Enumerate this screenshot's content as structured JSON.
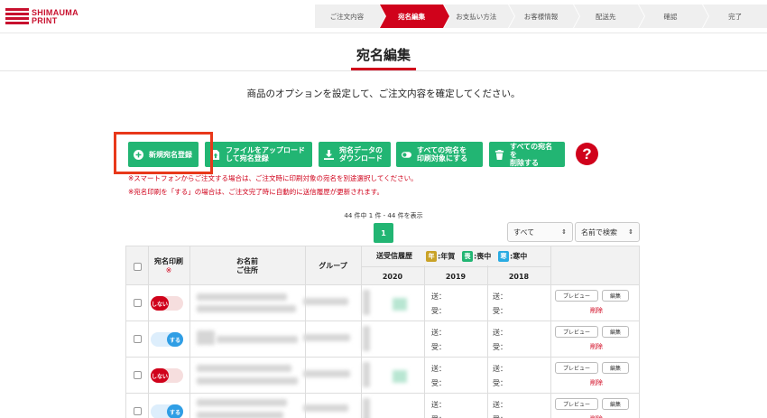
{
  "logo": {
    "line1": "SHIMAUMA",
    "line2": "PRINT"
  },
  "steps": [
    "ご注文内容",
    "宛名編集",
    "お支払い方法",
    "お客様情報",
    "配送先",
    "確認",
    "完了"
  ],
  "active_step_index": 1,
  "page": {
    "title": "宛名編集",
    "subtitle": "商品のオプションを設定して、ご注文内容を確定してください。"
  },
  "actions": {
    "new_address": "新規宛名登録",
    "upload_l1": "ファイルをアップロード",
    "upload_l2": "して宛名登録",
    "download_l1": "宛名データの",
    "download_l2": "ダウンロード",
    "print_all_l1": "すべての宛名を",
    "print_all_l2": "印刷対象にする",
    "delete_all_l1": "すべての宛名を",
    "delete_all_l2": "削除する",
    "help": "?"
  },
  "notes": {
    "note1": "※スマートフォンからご注文する場合は、ご注文時に印刷対象の宛名を別途選択してください。",
    "note2": "※宛名印刷を「する」の場合は、ご注文完了時に自動的に送信履歴が更新されます。"
  },
  "pagination": {
    "count_text": "44 件中 1 件 - 44 件を表示",
    "current_page": "1"
  },
  "filters": {
    "group_value": "すべて",
    "search_value": "名前で検索"
  },
  "table": {
    "headers": {
      "print": "宛名印刷",
      "print_mark": "※",
      "name_l1": "お名前",
      "name_l2": "ご住所",
      "group": "グループ",
      "history": "送受信履歴",
      "legend_nenga_badge": "年",
      "legend_nenga": ":年賀",
      "legend_mochu_badge": "喪",
      "legend_mochu": ":喪中",
      "legend_kanchu_badge": "寒",
      "legend_kanchu": ":寒中",
      "y2020": "2020",
      "y2019": "2019",
      "y2018": "2018"
    },
    "colors": {
      "nenga": "#c9a227",
      "mochu": "#22b573",
      "kanchu": "#29abe2"
    },
    "sent_label": "送：",
    "recv_label": "受：",
    "preview_label": "プレビュー",
    "edit_label": "編集",
    "delete_label": "削除",
    "rows": [
      {
        "print_state": "off",
        "toggle_label": "しない"
      },
      {
        "print_state": "on",
        "toggle_label": "する"
      },
      {
        "print_state": "off",
        "toggle_label": "しない"
      },
      {
        "print_state": "on",
        "toggle_label": "する"
      }
    ]
  }
}
